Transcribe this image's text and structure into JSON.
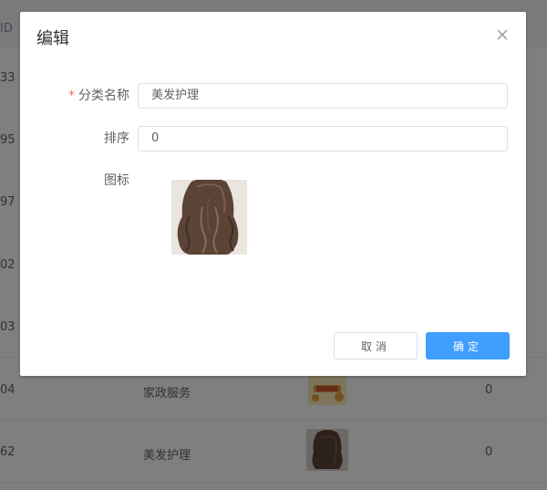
{
  "background_table": {
    "header": {
      "id_col": "ID"
    },
    "rows": [
      {
        "id": "33",
        "name": "",
        "sort": ""
      },
      {
        "id": "95",
        "name": "",
        "sort": ""
      },
      {
        "id": "97",
        "name": "",
        "sort": ""
      },
      {
        "id": "02",
        "name": "",
        "sort": ""
      },
      {
        "id": "03",
        "name": "",
        "sort": ""
      },
      {
        "id": "04",
        "name": "家政服务",
        "sort": "0"
      },
      {
        "id": "62",
        "name": "美发护理",
        "sort": "0"
      }
    ]
  },
  "dialog": {
    "title": "编辑",
    "fields": {
      "category_name": {
        "label": "分类名称",
        "value": "美发护理",
        "required": true
      },
      "sort": {
        "label": "排序",
        "value": "0"
      },
      "icon": {
        "label": "图标"
      }
    },
    "buttons": {
      "cancel": "取消",
      "confirm": "确定"
    }
  },
  "colors": {
    "primary": "#409eff",
    "required_star": "#f56c6c",
    "overlay": "rgba(0,0,0,0.5)"
  }
}
